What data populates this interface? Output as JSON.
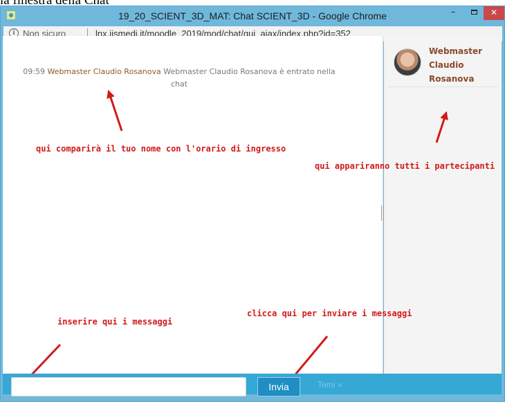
{
  "caption": "la finestra della Chat",
  "window": {
    "title": "19_20_SCIENT_3D_MAT: Chat SCIENT_3D - Google Chrome",
    "minimize_label": "–",
    "close_label": "✕"
  },
  "address_bar": {
    "info_icon": "info-icon",
    "security_label": "Non sicuro",
    "url": "lnx.iismedi.it/moodle_2019/mod/chat/gui_ajax/index.php?id=352"
  },
  "chat": {
    "messages": [
      {
        "time": "09:59",
        "user": "Webmaster Claudio Rosanova",
        "text": "Webmaster Claudio Rosanova è entrato nella chat"
      }
    ]
  },
  "users": [
    {
      "name": "Webmaster Claudio Rosanova"
    }
  ],
  "footer": {
    "input_value": "",
    "send_label": "Invia",
    "themes_label": "Temi »"
  },
  "annotations": {
    "name_time": "qui comparirà il tuo nome con l'orario di ingresso",
    "participants": "qui appariranno tutti i partecipanti",
    "insert_messages": "inserire qui i messaggi",
    "send_messages": "clicca qui per inviare i messaggi",
    "color": "#d11a1a"
  }
}
